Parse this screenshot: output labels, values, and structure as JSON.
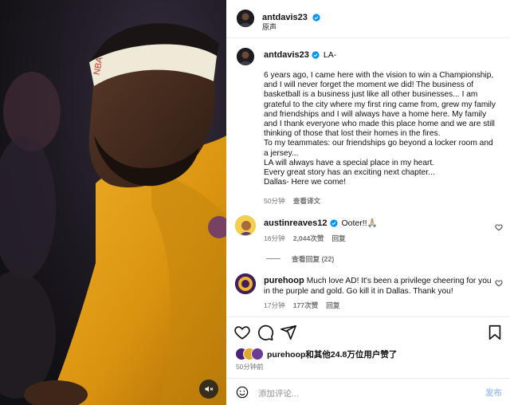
{
  "header": {
    "username": "antdavis23",
    "subtitle": "原声"
  },
  "caption": {
    "username": "antdavis23",
    "location_tag": "LA-",
    "text": "6 years ago, I came here with the vision to win a Championship, and I will never forget the moment we did! The business of basketball is a business just like all other businesses... I am grateful to the city where my first ring came from, grew my family and friendships and I will always have a home here. My family and I thank everyone who made this place home and we are still thinking of those that lost their homes in the fires.\nTo my teammates: our friendships go beyond a locker room and a jersey...\nLA will always have a special place in my heart.\nEvery great story has an exciting next chapter...\nDallas- Here we come!",
    "time": "50分钟",
    "translate": "查看译文"
  },
  "comments": [
    {
      "username": "austinreaves12",
      "verified": true,
      "text": "Ooter!!🙏🏼",
      "time": "16分钟",
      "likes": "2,044次赞",
      "reply": "回复",
      "view_replies": "查看回复 (22)"
    },
    {
      "username": "purehoop",
      "verified": false,
      "text": "Much love AD! It's been a privilege cheering for you in the purple and gold. Go kill it in Dallas. Thank you!",
      "time": "17分钟",
      "likes": "177次赞",
      "reply": "回复"
    }
  ],
  "likes_summary": "purehoop和其他24.8万位用户赞了",
  "post_time": "50分钟前",
  "comment_box": {
    "placeholder": "添加评论...",
    "post_label": "发布"
  },
  "icons": {
    "verified_color": "#0095f6",
    "like": "heart-icon",
    "comment": "comment-icon",
    "share": "share-icon",
    "save": "bookmark-icon",
    "emoji": "emoji-icon",
    "mute": "speaker-muted-icon"
  },
  "colors": {
    "jersey_gold": "#e6a418",
    "lakers_purple": "#552583",
    "link_disabled": "#a7c7f0"
  }
}
